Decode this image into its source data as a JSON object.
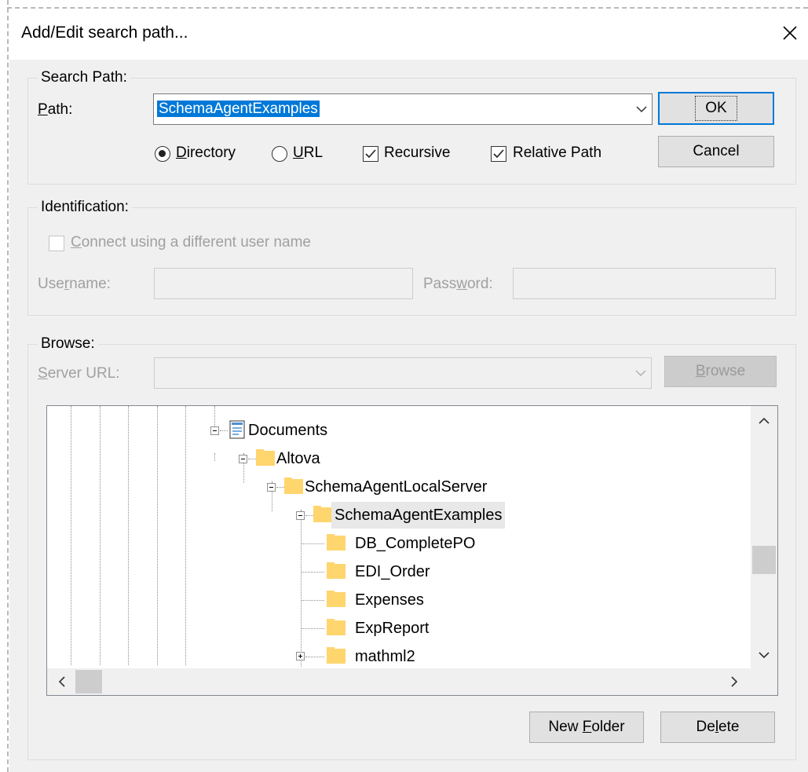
{
  "dialog": {
    "title": "Add/Edit search path..."
  },
  "search_path": {
    "group_label": "Search Path:",
    "path_label_accel": "P",
    "path_label_rest": "ath:",
    "path_value": "SchemaAgentExamples",
    "ok_label": "OK",
    "cancel_label": "Cancel",
    "directory_accel": "D",
    "directory_rest": "irectory",
    "url_accel": "U",
    "url_rest": "RL",
    "recursive_label": "Recursive",
    "relative_label": "Relative Path",
    "directory_selected": true,
    "recursive_checked": true,
    "relative_checked": true
  },
  "identification": {
    "group_label": "Identification:",
    "connect_accel": "C",
    "connect_rest": "onnect using a different user name",
    "username_pre": "Use",
    "username_accel": "r",
    "username_post": "name:",
    "password_pre": "Pass",
    "password_accel": "w",
    "password_post": "ord:"
  },
  "browse": {
    "group_label": "Browse:",
    "server_url_accel": "S",
    "server_url_rest": "erver URL:",
    "browse_accel": "B",
    "browse_rest": "rowse",
    "new_folder_pre": "New ",
    "new_folder_accel": "F",
    "new_folder_post": "older",
    "delete_pre": "De",
    "delete_accel": "l",
    "delete_post": "ete",
    "tree": {
      "documents": "Documents",
      "altova": "Altova",
      "local_server": "SchemaAgentLocalServer",
      "examples": "SchemaAgentExamples",
      "children": [
        "DB_CompletePO",
        "EDI_Order",
        "Expenses",
        "ExpReport",
        "mathml2"
      ]
    }
  },
  "colors": {
    "accent": "#0078d7",
    "folder": "#ffd56e",
    "dialog_bg": "#f0f0f0"
  }
}
